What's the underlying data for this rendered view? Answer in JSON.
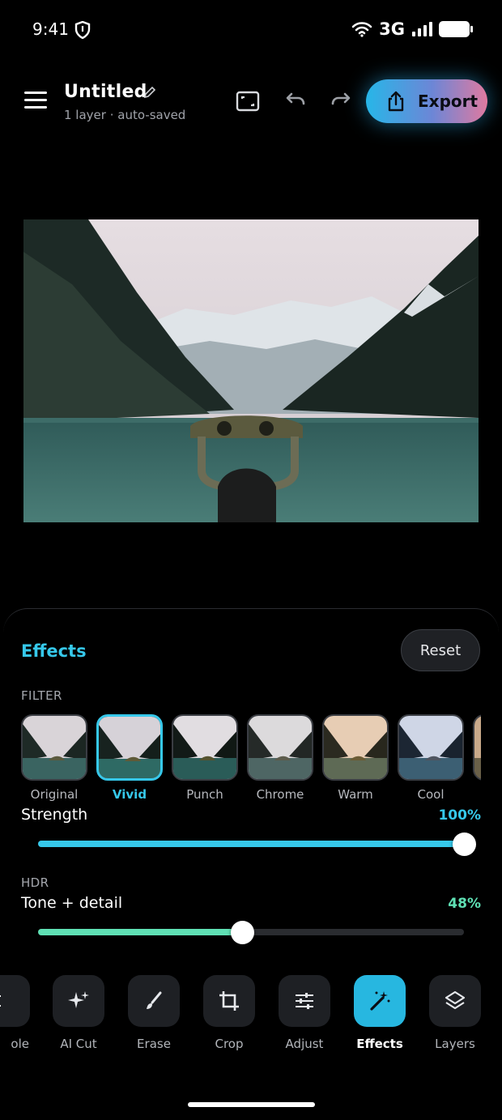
{
  "status_bar": {
    "time": "9:41",
    "network": "3G"
  },
  "header": {
    "title": "Untitled",
    "subtitle": "1 layer · auto-saved",
    "export_label": "Export"
  },
  "colors": {
    "accent": "#36c8ea",
    "hdr_accent": "#5fe0b4",
    "panel_bg": "#000000"
  },
  "effects_panel": {
    "title": "Effects",
    "reset_label": "Reset",
    "filter_section": "FILTER",
    "filters": [
      {
        "name": "Original",
        "selected": false
      },
      {
        "name": "Vivid",
        "selected": true
      },
      {
        "name": "Punch",
        "selected": false
      },
      {
        "name": "Chrome",
        "selected": false
      },
      {
        "name": "Warm",
        "selected": false
      },
      {
        "name": "Cool",
        "selected": false
      }
    ],
    "strength": {
      "label": "Strength",
      "value_text": "100%",
      "value": 100
    },
    "hdr_section": "HDR",
    "tone": {
      "label": "Tone + detail",
      "value_text": "48%",
      "value": 48
    }
  },
  "toolbar": {
    "items": [
      {
        "label": "ole",
        "icon": "partial-icon",
        "active": false
      },
      {
        "label": "AI Cut",
        "icon": "sparkle-icon",
        "active": false
      },
      {
        "label": "Erase",
        "icon": "brush-icon",
        "active": false
      },
      {
        "label": "Crop",
        "icon": "crop-icon",
        "active": false
      },
      {
        "label": "Adjust",
        "icon": "sliders-icon",
        "active": false
      },
      {
        "label": "Effects",
        "icon": "magic-wand-icon",
        "active": true
      },
      {
        "label": "Layers",
        "icon": "layers-icon",
        "active": false
      }
    ]
  }
}
